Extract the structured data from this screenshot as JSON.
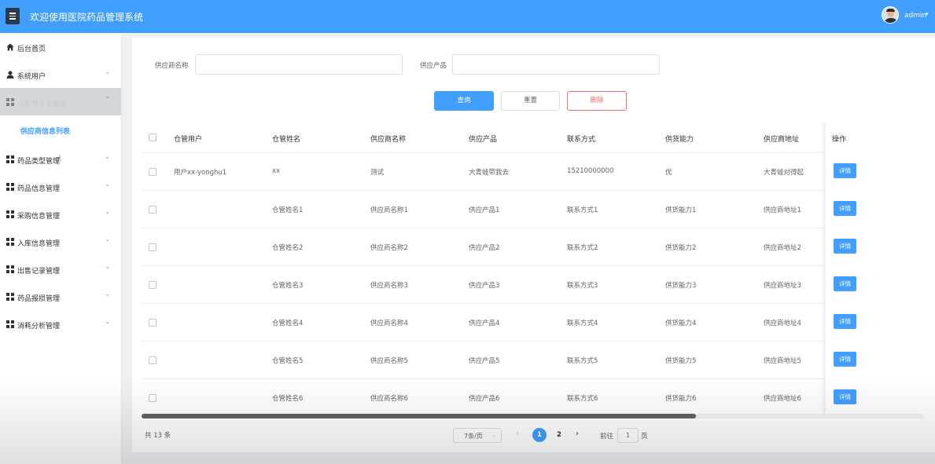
{
  "header": {
    "title": "欢迎使用医院药品管理系统",
    "username": "admin",
    "brand_color": "#409eff"
  },
  "sidebar": {
    "items": [
      {
        "label": "后台首页",
        "icon": "home-icon",
        "has_chevron": false
      },
      {
        "label": "系统用户",
        "icon": "user-icon",
        "has_chevron": true
      },
      {
        "label": "供应商信息管理",
        "icon": "grid-icon",
        "has_chevron": true,
        "active": true
      },
      {
        "label": "药品类型管理",
        "icon": "grid-icon",
        "has_chevron": true
      },
      {
        "label": "药品信息管理",
        "icon": "grid-icon",
        "has_chevron": true
      },
      {
        "label": "采购信息管理",
        "icon": "grid-icon",
        "has_chevron": true
      },
      {
        "label": "入库信息管理",
        "icon": "grid-icon",
        "has_chevron": true
      },
      {
        "label": "出售记录管理",
        "icon": "grid-icon",
        "has_chevron": true
      },
      {
        "label": "药品报损管理",
        "icon": "grid-icon",
        "has_chevron": true
      },
      {
        "label": "消耗分析管理",
        "icon": "grid-icon",
        "has_chevron": true
      }
    ],
    "submenu_item": "供应商信息列表"
  },
  "search": {
    "supplier_name_label": "供应商名称",
    "supplier_name_value": "",
    "product_label": "供应产品",
    "product_value": "",
    "query_button": "查询",
    "reset_button": "重置",
    "delete_button": "删除"
  },
  "table": {
    "columns": [
      "仓管用户",
      "仓管姓名",
      "供应商名称",
      "供应产品",
      "联系方式",
      "供货能力",
      "供应商地址",
      "操作"
    ],
    "rows": [
      [
        "用户xx-yonghu1",
        "xx",
        "测试",
        "大青蛙带我去",
        "15210000000",
        "优",
        "大青蛙对得起"
      ],
      [
        "",
        "仓管姓名1",
        "供应商名称1",
        "供应产品1",
        "联系方式1",
        "供货能力1",
        "供应商地址1"
      ],
      [
        "",
        "仓管姓名2",
        "供应商名称2",
        "供应产品2",
        "联系方式2",
        "供货能力2",
        "供应商地址2"
      ],
      [
        "",
        "仓管姓名3",
        "供应商名称3",
        "供应产品3",
        "联系方式3",
        "供货能力3",
        "供应商地址3"
      ],
      [
        "",
        "仓管姓名4",
        "供应商名称4",
        "供应产品4",
        "联系方式4",
        "供货能力4",
        "供应商地址4"
      ],
      [
        "",
        "仓管姓名5",
        "供应商名称5",
        "供应产品5",
        "联系方式5",
        "供货能力5",
        "供应商地址5"
      ],
      [
        "",
        "仓管姓名6",
        "供应商名称6",
        "供应产品6",
        "联系方式6",
        "供货能力6",
        "供应商地址6"
      ]
    ],
    "detail_button": "详情"
  },
  "pagination": {
    "total_text": "共 13 条",
    "page_size": "7条/页",
    "pages": [
      "1",
      "2"
    ],
    "current_page": "1",
    "goto_label": "前往",
    "goto_value": "1",
    "goto_suffix": "页"
  }
}
